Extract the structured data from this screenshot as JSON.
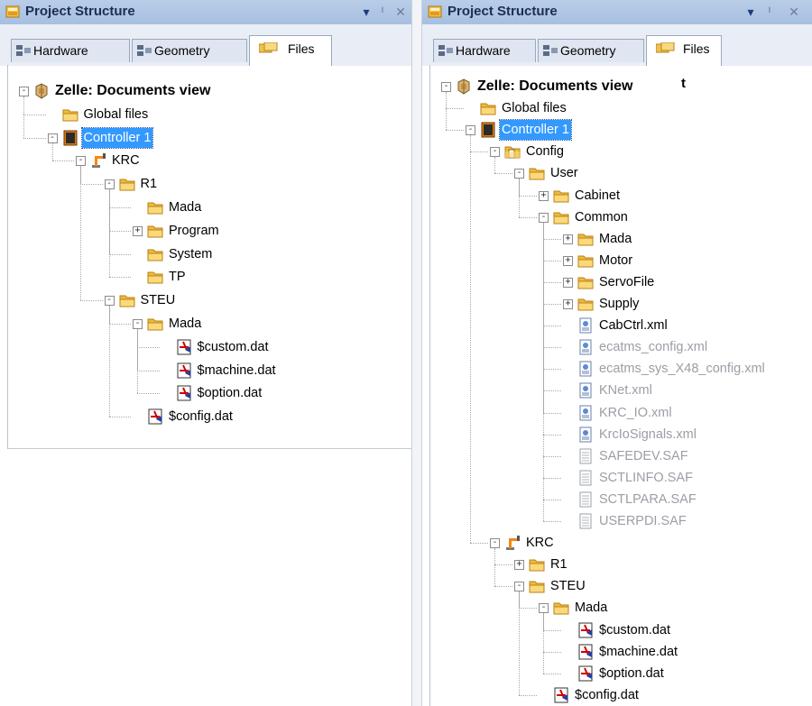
{
  "left": {
    "title": "Project Structure",
    "controls": {
      "dropdown": "▾",
      "pin": "ᛌ",
      "close": "✕"
    },
    "tabs": [
      {
        "label": "Hardware",
        "icon": "hardware-icon"
      },
      {
        "label": "Geometry",
        "icon": "geometry-icon"
      },
      {
        "label": "Files",
        "icon": "files-icon",
        "active": true
      }
    ],
    "tree": [
      {
        "label": "Zelle: Documents view",
        "icon": "cell-icon"
      },
      {
        "label": "Global files",
        "icon": "folder-icon"
      },
      {
        "label": "Controller 1",
        "icon": "controller-icon",
        "selected": true
      },
      {
        "label": "KRC",
        "icon": "robot-icon"
      },
      {
        "label": "R1",
        "icon": "folder-icon"
      },
      {
        "label": "Mada",
        "icon": "folder-icon"
      },
      {
        "label": "Program",
        "icon": "folder-icon"
      },
      {
        "label": "System",
        "icon": "folder-icon"
      },
      {
        "label": "TP",
        "icon": "folder-icon"
      },
      {
        "label": "STEU",
        "icon": "folder-icon"
      },
      {
        "label": "Mada",
        "icon": "folder-icon"
      },
      {
        "label": "$custom.dat",
        "icon": "dat-file-icon"
      },
      {
        "label": "$machine.dat",
        "icon": "dat-file-icon"
      },
      {
        "label": "$option.dat",
        "icon": "dat-file-icon"
      },
      {
        "label": "$config.dat",
        "icon": "dat-file-icon"
      }
    ]
  },
  "right": {
    "title": "Project Structure",
    "controls": {
      "dropdown": "▾",
      "pin": "ᛌ",
      "close": "✕"
    },
    "tabs": [
      {
        "label": "Hardware",
        "icon": "hardware-icon"
      },
      {
        "label": "Geometry",
        "icon": "geometry-icon"
      },
      {
        "label": "Files",
        "icon": "files-icon",
        "active": true
      }
    ],
    "stray_text": "t",
    "tree": [
      {
        "label": "Zelle: Documents view",
        "icon": "cell-icon"
      },
      {
        "label": "Global files",
        "icon": "folder-icon"
      },
      {
        "label": "Controller 1",
        "icon": "controller-icon",
        "selected": true
      },
      {
        "label": "Config",
        "icon": "config-folder-icon"
      },
      {
        "label": "User",
        "icon": "folder-icon"
      },
      {
        "label": "Cabinet",
        "icon": "folder-icon"
      },
      {
        "label": "Common",
        "icon": "folder-icon"
      },
      {
        "label": "Mada",
        "icon": "folder-icon"
      },
      {
        "label": "Motor",
        "icon": "folder-icon"
      },
      {
        "label": "ServoFile",
        "icon": "folder-icon"
      },
      {
        "label": "Supply",
        "icon": "folder-icon"
      },
      {
        "label": "CabCtrl.xml",
        "icon": "xml-file-icon"
      },
      {
        "label": "ecatms_config.xml",
        "icon": "xml-file-icon",
        "grey": true
      },
      {
        "label": "ecatms_sys_X48_config.xml",
        "icon": "xml-file-icon",
        "grey": true
      },
      {
        "label": "KNet.xml",
        "icon": "xml-file-icon",
        "grey": true
      },
      {
        "label": "KRC_IO.xml",
        "icon": "xml-file-icon",
        "grey": true
      },
      {
        "label": "KrcIoSignals.xml",
        "icon": "xml-file-icon",
        "grey": true
      },
      {
        "label": "SAFEDEV.SAF",
        "icon": "saf-file-icon",
        "grey": true
      },
      {
        "label": "SCTLINFO.SAF",
        "icon": "saf-file-icon",
        "grey": true
      },
      {
        "label": "SCTLPARA.SAF",
        "icon": "saf-file-icon",
        "grey": true
      },
      {
        "label": "USERPDI.SAF",
        "icon": "saf-file-icon",
        "grey": true
      },
      {
        "label": "KRC",
        "icon": "robot-icon"
      },
      {
        "label": "R1",
        "icon": "folder-icon"
      },
      {
        "label": "STEU",
        "icon": "folder-icon"
      },
      {
        "label": "Mada",
        "icon": "folder-icon"
      },
      {
        "label": "$custom.dat",
        "icon": "dat-file-icon"
      },
      {
        "label": "$machine.dat",
        "icon": "dat-file-icon"
      },
      {
        "label": "$option.dat",
        "icon": "dat-file-icon"
      },
      {
        "label": "$config.dat",
        "icon": "dat-file-icon"
      }
    ]
  }
}
